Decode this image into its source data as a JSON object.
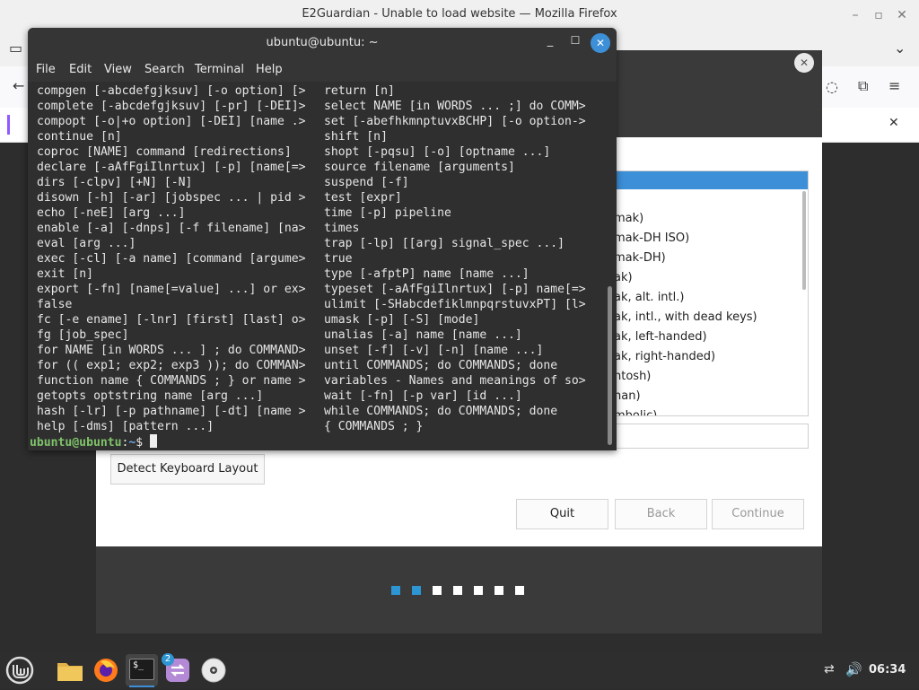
{
  "firefox": {
    "window_title": "E2Guardian - Unable to load website — Mozilla Firefox"
  },
  "installer": {
    "keyboard_variants": [
      "mak)",
      "mak-DH ISO)",
      "mak-DH)",
      "ak)",
      "ak, alt. intl.)",
      "ak, intl., with dead keys)",
      "ak, left-handed)",
      "ak, right-handed)",
      "ntosh)",
      "nan)",
      "mbolic)"
    ],
    "detect_button": "Detect Keyboard Layout",
    "quit_button": "Quit",
    "back_button": "Back",
    "continue_button": "Continue",
    "steps_total": 7,
    "steps_done": 2
  },
  "terminal": {
    "title": "ubuntu@ubuntu: ~",
    "menu": [
      "File",
      "Edit",
      "View",
      "Search",
      "Terminal",
      "Help"
    ],
    "left_lines": [
      "compgen [-abcdefgjksuv] [-o option] [>",
      "complete [-abcdefgjksuv] [-pr] [-DEI]>",
      "compopt [-o|+o option] [-DEI] [name .>",
      "continue [n]",
      "coproc [NAME] command [redirections]",
      "declare [-aAfFgiIlnrtux] [-p] [name[=>",
      "dirs [-clpv] [+N] [-N]",
      "disown [-h] [-ar] [jobspec ... | pid >",
      "echo [-neE] [arg ...]",
      "enable [-a] [-dnps] [-f filename] [na>",
      "eval [arg ...]",
      "exec [-cl] [-a name] [command [argume>",
      "exit [n]",
      "export [-fn] [name[=value] ...] or ex>",
      "false",
      "fc [-e ename] [-lnr] [first] [last] o>",
      "fg [job_spec]",
      "for NAME [in WORDS ... ] ; do COMMAND>",
      "for (( exp1; exp2; exp3 )); do COMMAN>",
      "function name { COMMANDS ; } or name >",
      "getopts optstring name [arg ...]",
      "hash [-lr] [-p pathname] [-dt] [name >",
      "help [-dms] [pattern ...]"
    ],
    "right_lines": [
      "return [n]",
      "select NAME [in WORDS ... ;] do COMM>",
      "set [-abefhkmnptuvxBCHP] [-o option->",
      "shift [n]",
      "shopt [-pqsu] [-o] [optname ...]",
      "source filename [arguments]",
      "suspend [-f]",
      "test [expr]",
      "time [-p] pipeline",
      "times",
      "trap [-lp] [[arg] signal_spec ...]",
      "true",
      "type [-afptP] name [name ...]",
      "typeset [-aAfFgiIlnrtux] [-p] name[=>",
      "ulimit [-SHabcdefiklmnpqrstuvxPT] [l>",
      "umask [-p] [-S] [mode]",
      "unalias [-a] name [name ...]",
      "unset [-f] [-v] [-n] [name ...]",
      "until COMMANDS; do COMMANDS; done",
      "variables - Names and meanings of so>",
      "wait [-fn] [-p var] [id ...]",
      "while COMMANDS; do COMMANDS; done",
      "{ COMMANDS ; }"
    ],
    "prompt_user": "ubuntu@ubuntu",
    "prompt_path": "~",
    "prompt_sep_colon": ":",
    "prompt_symbol": "$ "
  },
  "taskbar": {
    "clock": "06:34",
    "installer_badge": "2",
    "terminal_glyph": "$_"
  },
  "colors": {
    "accent": "#3d8fd8",
    "step_done": "#2e95d3",
    "prompt_user": "#7fc36a",
    "prompt_path": "#6fa8e8",
    "terminal_bg": "#2f2f2f"
  }
}
